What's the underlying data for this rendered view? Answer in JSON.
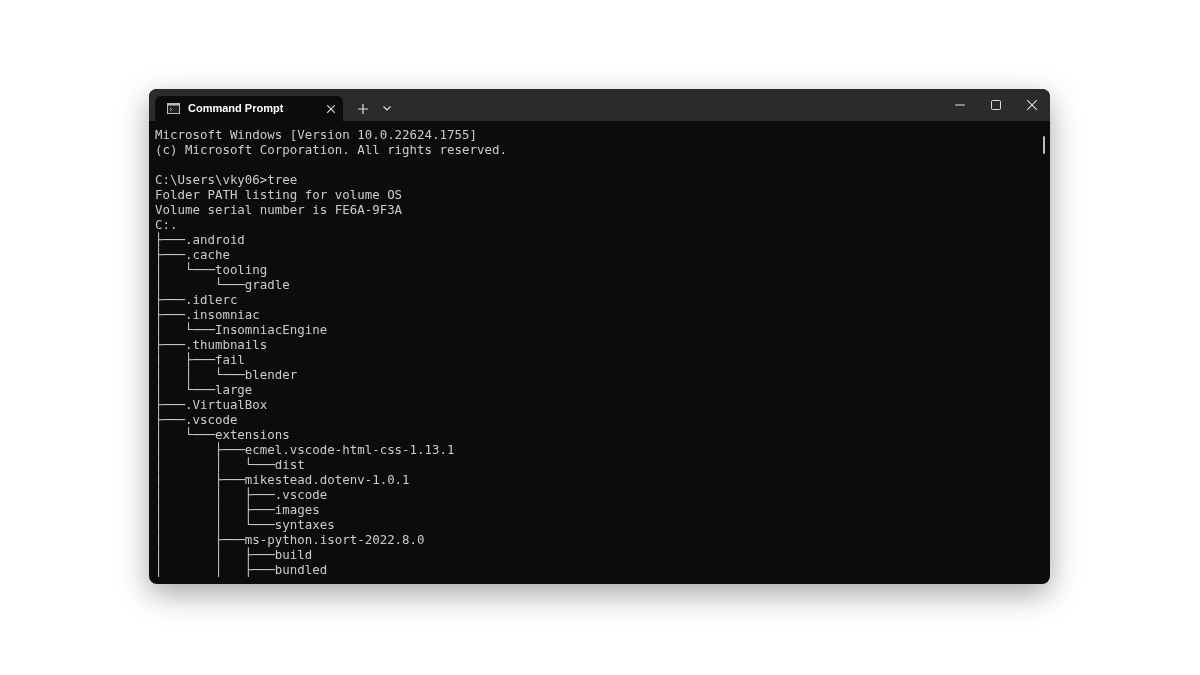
{
  "window": {
    "tabs": [
      {
        "title": "Command Prompt",
        "selected": true
      }
    ]
  },
  "console": {
    "blocks": [
      [
        "Microsoft Windows [Version 10.0.22624.1755]",
        "(c) Microsoft Corporation. All rights reserved."
      ],
      [
        "C:\\Users\\vky06>tree",
        "Folder PATH listing for volume OS",
        "Volume serial number is FE6A-9F3A",
        "C:.",
        "├───.android",
        "├───.cache",
        "│   └───tooling",
        "│       └───gradle",
        "├───.idlerc",
        "├───.insomniac",
        "│   └───InsomniacEngine",
        "├───.thumbnails",
        "│   ├───fail",
        "│   │   └───blender",
        "│   └───large",
        "├───.VirtualBox",
        "├───.vscode",
        "│   └───extensions",
        "│       ├───ecmel.vscode-html-css-1.13.1",
        "│       │   └───dist",
        "│       ├───mikestead.dotenv-1.0.1",
        "│       │   ├───.vscode",
        "│       │   ├───images",
        "│       │   └───syntaxes",
        "│       ├───ms-python.isort-2022.8.0",
        "│       │   ├───build",
        "│       │   ├───bundled"
      ]
    ]
  }
}
